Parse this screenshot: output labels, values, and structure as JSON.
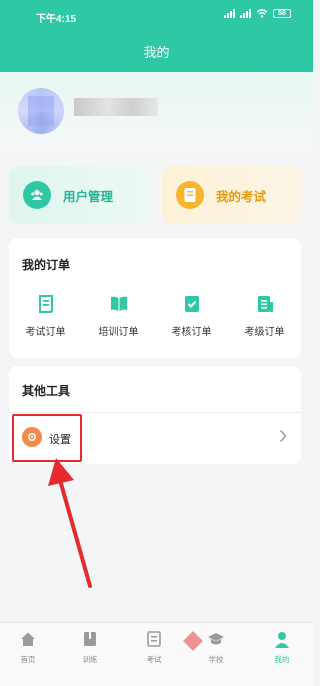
{
  "status_bar": {
    "time": "下午4:15",
    "battery": "58"
  },
  "header": {
    "title": "我的"
  },
  "quick_actions": [
    {
      "label": "用户管理",
      "icon": "user-group-icon"
    },
    {
      "label": "我的考试",
      "icon": "exam-doc-icon"
    }
  ],
  "orders": {
    "title": "我的订单",
    "items": [
      {
        "label": "考试订单",
        "icon": "exam-order-icon"
      },
      {
        "label": "培训订单",
        "icon": "book-icon"
      },
      {
        "label": "考核订单",
        "icon": "check-clipboard-icon"
      },
      {
        "label": "考级订单",
        "icon": "document-list-icon"
      }
    ]
  },
  "tools": {
    "title": "其他工具",
    "items": [
      {
        "label": "设置",
        "icon": "settings-icon"
      }
    ]
  },
  "tabbar": {
    "items": [
      {
        "label": "首页",
        "icon": "home-icon"
      },
      {
        "label": "训练",
        "icon": "training-icon"
      },
      {
        "label": "考试",
        "icon": "exam-icon"
      },
      {
        "label": "学校",
        "icon": "school-icon"
      },
      {
        "label": "我的",
        "icon": "profile-icon",
        "active": true
      }
    ]
  },
  "colors": {
    "brand": "#2ec9a4",
    "exam_accent": "#f7b42c",
    "setting_icon": "#f28a4a",
    "annotation": "#e52b2b"
  }
}
